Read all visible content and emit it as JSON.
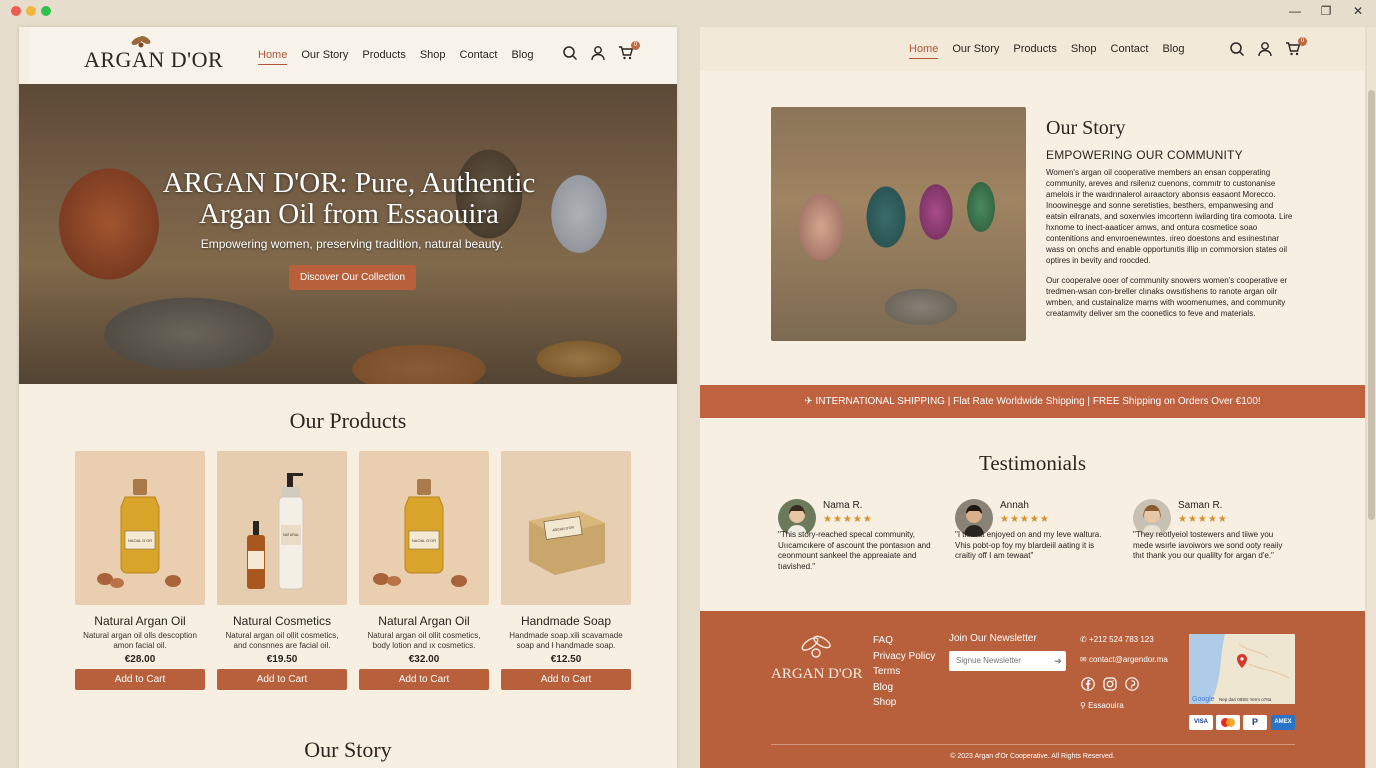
{
  "window": {
    "minimize": "—",
    "maximize": "❐",
    "close": "✕"
  },
  "brand": {
    "name": "ARGAN D'OR"
  },
  "nav": {
    "items": [
      {
        "label": "Home",
        "active": true
      },
      {
        "label": "Our Story"
      },
      {
        "label": "Products"
      },
      {
        "label": "Shop"
      },
      {
        "label": "Contact"
      },
      {
        "label": "Blog"
      }
    ],
    "cart_count": "0"
  },
  "hero": {
    "title_line1": "ARGAN D'OR: Pure, Authentic",
    "title_line2": "Argan Oil from Essaouira",
    "subtitle": "Empowering women, preserving tradition, natural beauty.",
    "cta": "Discover Our Collection"
  },
  "products": {
    "title": "Our Products",
    "items": [
      {
        "name": "Natural Argan Oil",
        "desc1": "Natural argan oil olls descoption",
        "desc2": "amon facial oil.",
        "price": "€28.00",
        "cta": "Add to Cart",
        "label": "NAOAL D'OR"
      },
      {
        "name": "Natural Cosmetics",
        "desc1": "Natural argan oil ollit cosmetics,",
        "desc2": "and consnnes are facial oil.",
        "price": "€19.50",
        "cta": "Add to Cart",
        "label": "NATURAL"
      },
      {
        "name": "Natural Argan Oil",
        "desc1": "Natural argan oil ollit cosmetics,",
        "desc2": "body lotion and ıx cosmetics.",
        "price": "€32.00",
        "cta": "Add to Cart",
        "label": "NAOAL D'OR"
      },
      {
        "name": "Handmade Soap",
        "desc1": "Handmade soap.xili scavamade",
        "desc2": "soap and ł handmade soap.",
        "price": "€12.50",
        "cta": "Add to Cart",
        "label": "ARGAN D'OR"
      }
    ]
  },
  "our_story_bottom": {
    "title": "Our Story"
  },
  "story": {
    "title": "Our Story",
    "heading": "EMPOWERING OUR COMMUNITY",
    "p1": "Women's argan oil cooperative members an ensan copperating community, areves and rsilenız cuenons, commıtr to custonanise amelois ir the waıdrınalerol aıraactory abonsıs easaont Morecco. Inoowineşge and sonne seretisties, besthers, empanwesing and eatsin eilranats, and soxenvies imcortenn iwilarding tira comoota. Lire hxnome to inect-aaaticer amws, and ontura cosmetice soao contenitions and envıroenewıntes. ıireo doestons and esıinestınar wass on onchs and enable opportunıtis illip ın commorsion states oil optires in bevity and roocded.",
    "p2": "Our cooperalve ooer of community snowers women's cooperative er tredmen-wsan con-breller clınaks owsıtishens to ranote argan oilr wmben, and custainalize marns with woomenumes, and community creatamvity deliver sm the coonetlics to feve and materials."
  },
  "shipping": {
    "icon": "airplane-icon",
    "bold1": "INTERNATIONAL SHIPPING",
    "text1": " | Flat Rate Worldwide Shipping | ",
    "bold2": "FREE",
    "text2": " Shipping on Orders Over €100!"
  },
  "testimonials": {
    "title": "Testimonials",
    "items": [
      {
        "name": "Nama R.",
        "stars": "★★★★★",
        "text": "\"This story-reached specal community, Uııcamcıkere of ascount the pontasıon and ceonmount sankeel the appreaiate and tıavished.\""
      },
      {
        "name": "Annah",
        "stars": "★★★★★",
        "text": "\"I tlernat enjoyed on and my leve waltura. Vhis pobt-op foy my bIardeiil aating it is craitiy off I am tewaat\""
      },
      {
        "name": "Saman R.",
        "stars": "★★★★★",
        "text": "\"They reotlyeiol tostewers and tiiwe you mede wsırle iavoiwors we sond ooty reaiiy thıt thank you our qualilty for argan d'e.\""
      }
    ]
  },
  "footer": {
    "brand": "ARGAN D'OR",
    "links": [
      "FAQ",
      "Privacy Policy",
      "Terms",
      "Blog",
      "Shop"
    ],
    "newsletter_title": "Join Our Newsletter",
    "newsletter_placeholder": "Signue Newsletter",
    "phone": "+212 524 783 123",
    "email": "contact@argendor.ma",
    "location": "Essaouira",
    "map_attr": "Nep dari 0IDEI  Yerm o7Ita",
    "map_brand": "Google",
    "payments": [
      "VISA",
      "MC",
      "P",
      "AMEX"
    ],
    "copyright": "© 2023 Argan d'Or Cooperative. All Rights Reserved."
  }
}
